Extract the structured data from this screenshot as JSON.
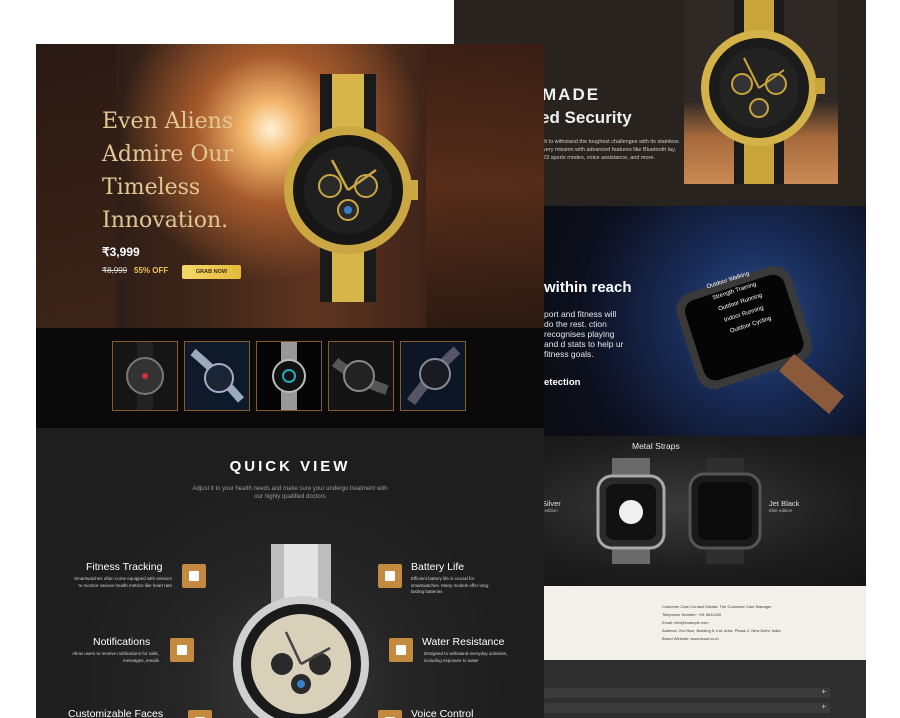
{
  "back": {
    "brand_word": "MADE",
    "security_title": "ed Security",
    "security_desc": "uilt to withstand the toughest challenges with its stainless every mission with advanced features like Bluetooth lay, 123 sports modes, voice assistance, and more.",
    "reach_title": "within reach",
    "reach_desc": "port and fitness will do the rest. ction recognises playing and d stats to help ur fitness goals.",
    "detection_label": "etection",
    "screen_items": [
      "Outdoor Walking",
      "Strength Training",
      "Outdoor Running",
      "Indoor Running",
      "Outdoor Cycling"
    ],
    "metal_straps": "Metal Straps",
    "silver_label": "Silver",
    "silver_sub": "t edition",
    "jet_label": "Jet Black",
    "jet_sub": "Elite edition",
    "info_lines": [
      "Customer Care Contact Details: The Customer Care Manager",
      "Telephone Number: +91 9811400",
      "Email: info@example.com",
      "Address: 2nd floor, Building 5, Ind. Area, Phase 2, New Delhi, India",
      "Brand Website: www.fossil.co.in"
    ]
  },
  "hero": {
    "headline": [
      "Even Aliens",
      "Admire Our",
      "Timeless",
      "Innovation."
    ],
    "price": "₹3,999",
    "old_price": "₹8,999",
    "discount": "55% OFF",
    "cta": "GRAB NOW"
  },
  "quick_view": {
    "title": "QUICK VIEW",
    "subtitle": "Adjust it to your health needs and make sure your undergo treatment with our highly qualified doctors",
    "features": [
      {
        "title": "Fitness Tracking",
        "desc": "Smartwatches often come equipped with sensors to monitor various health metrics like heart rate"
      },
      {
        "title": "Battery Life",
        "desc": "Efficient battery life is crucial for smartwatches. Many models offer long-lasting batteries"
      },
      {
        "title": "Notifications",
        "desc": "Allow users to receive notifications for calls, messages, emails"
      },
      {
        "title": "Water Resistance",
        "desc": "Designed to withstand everyday activities, including exposure to water"
      },
      {
        "title": "Customizable Faces",
        "desc": ""
      },
      {
        "title": "Voice Control",
        "desc": ""
      }
    ]
  },
  "colors": {
    "gold_text": "#e3c793",
    "cta_gold": "#f0c54e",
    "feature_icon": "#c48a3f"
  }
}
